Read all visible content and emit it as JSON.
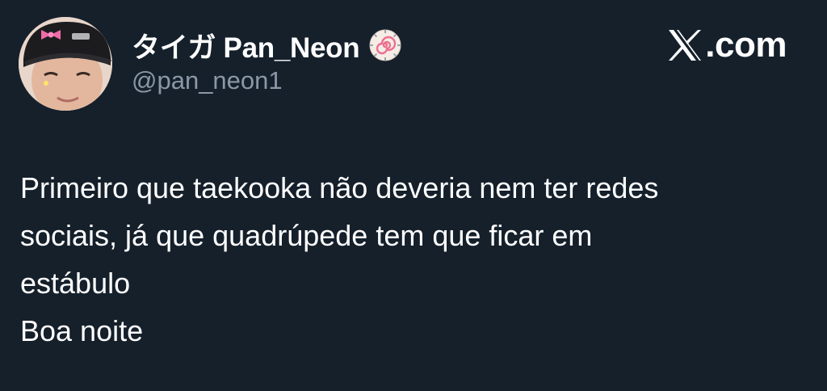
{
  "author": {
    "display_name": "タイガ Pan_Neon",
    "handle": "@pan_neon1",
    "avatar_icon": "profile-photo",
    "badge_icon": "naruto-fishcake-emoji"
  },
  "brand": {
    "logo_icon": "x-logo-icon",
    "label": ".com"
  },
  "tweet": {
    "lines": [
      "Primeiro que taekooka não deveria nem ter redes",
      "sociais, já que quadrúpede tem que ficar em",
      "estábulo",
      "Boa noite"
    ]
  },
  "colors": {
    "background": "#15202b",
    "text_primary": "#ffffff",
    "text_secondary": "#8b98a5"
  }
}
